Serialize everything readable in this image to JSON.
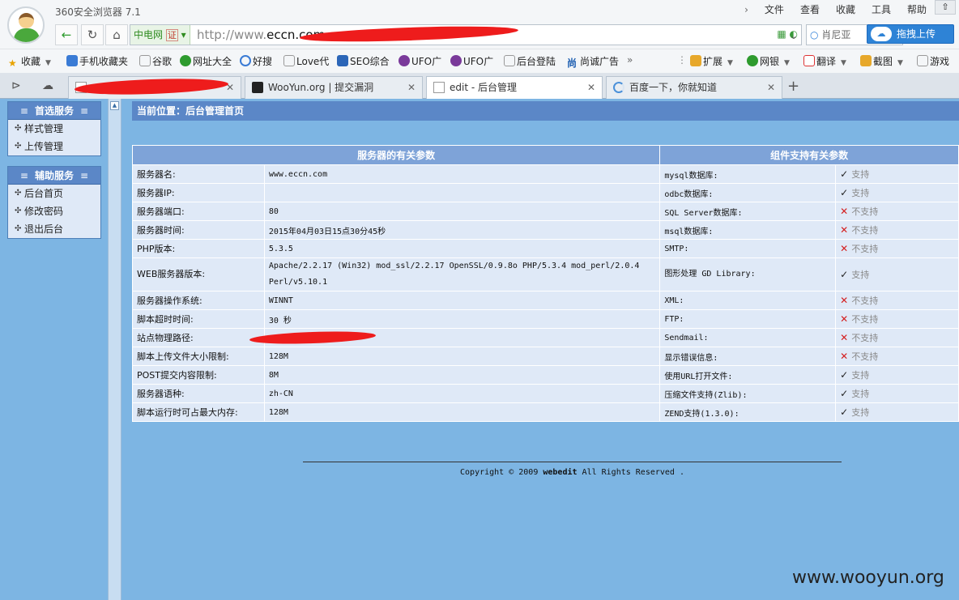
{
  "browser": {
    "app_title": "360安全浏览器 7.1",
    "menu": [
      "文件",
      "查看",
      "收藏",
      "工具",
      "帮助"
    ],
    "cert_label": "中电网",
    "cert_mark": "证",
    "url_prefix": "http://www.",
    "url_host": "eccn.",
    "url_rest": "com",
    "search_hint": "肖尼亚",
    "upload_label": "拖拽上传",
    "favorites": [
      "收藏",
      "手机收藏夹",
      "谷歌",
      "网址大全",
      "好搜",
      "Love代",
      "SEO综合",
      "UFO广",
      "UFO广",
      "后台登陆",
      "尚诚广告"
    ],
    "extras": [
      "扩展",
      "网银",
      "翻译",
      "截图",
      "游戏"
    ],
    "tabs": [
      "WooYun.org | 提交漏洞",
      "edit - 后台管理",
      "百度一下，你就知道"
    ]
  },
  "sidebar": {
    "groups": [
      {
        "title": "首选服务",
        "items": [
          "样式管理",
          "上传管理"
        ]
      },
      {
        "title": "辅助服务",
        "items": [
          "后台首页",
          "修改密码",
          "退出后台"
        ]
      }
    ]
  },
  "main": {
    "breadcrumb": "当前位置：后台管理首页",
    "server_header": "服务器的有关参数",
    "component_header": "组件支持有关参数",
    "rows": [
      {
        "label": "服务器名:",
        "value": "www.eccn.com",
        "comp": "mysql数据库:",
        "status": "支持"
      },
      {
        "label": "服务器IP:",
        "value": "",
        "comp": "odbc数据库:",
        "status": "支持"
      },
      {
        "label": "服务器端口:",
        "value": "80",
        "comp": "SQL Server数据库:",
        "status": "不支持"
      },
      {
        "label": "服务器时间:",
        "value": "2015年04月03日15点30分45秒",
        "comp": "msql数据库:",
        "status": "不支持"
      },
      {
        "label": "PHP版本:",
        "value": "5.3.5",
        "comp": "SMTP:",
        "status": "不支持"
      },
      {
        "label": "WEB服务器版本:",
        "value": "Apache/2.2.17 (Win32) mod_ssl/2.2.17 OpenSSL/0.9.8o PHP/5.3.4 mod_perl/2.0.4 Perl/v5.10.1",
        "comp": "图形处理 GD Library:",
        "status": "支持"
      },
      {
        "label": "服务器操作系统:",
        "value": "WINNT",
        "comp": "XML:",
        "status": "不支持"
      },
      {
        "label": "脚本超时时间:",
        "value": "30 秒",
        "comp": "FTP:",
        "status": "不支持"
      },
      {
        "label": "站点物理路径:",
        "value": "",
        "comp": "Sendmail:",
        "status": "不支持"
      },
      {
        "label": "脚本上传文件大小限制:",
        "value": "128M",
        "comp": "显示错误信息:",
        "status": "不支持"
      },
      {
        "label": "POST提交内容限制:",
        "value": "8M",
        "comp": "使用URL打开文件:",
        "status": "支持"
      },
      {
        "label": "服务器语种:",
        "value": "zh-CN",
        "comp": "压缩文件支持(Zlib):",
        "status": "支持"
      },
      {
        "label": "脚本运行时可占最大内存:",
        "value": "128M",
        "comp": "ZEND支持(1.3.0):",
        "status": "支持"
      }
    ],
    "copyright_pre": "Copyright © 2009 ",
    "copyright_brand": "webedit",
    "copyright_post": " All Rights Reserved ."
  },
  "watermark": "www.wooyun.org",
  "colors": {
    "page_bg": "#7db5e3",
    "header_blue": "#5b87c7",
    "cell_bg": "#dfe9f7",
    "error_red": "#d41f1f"
  }
}
